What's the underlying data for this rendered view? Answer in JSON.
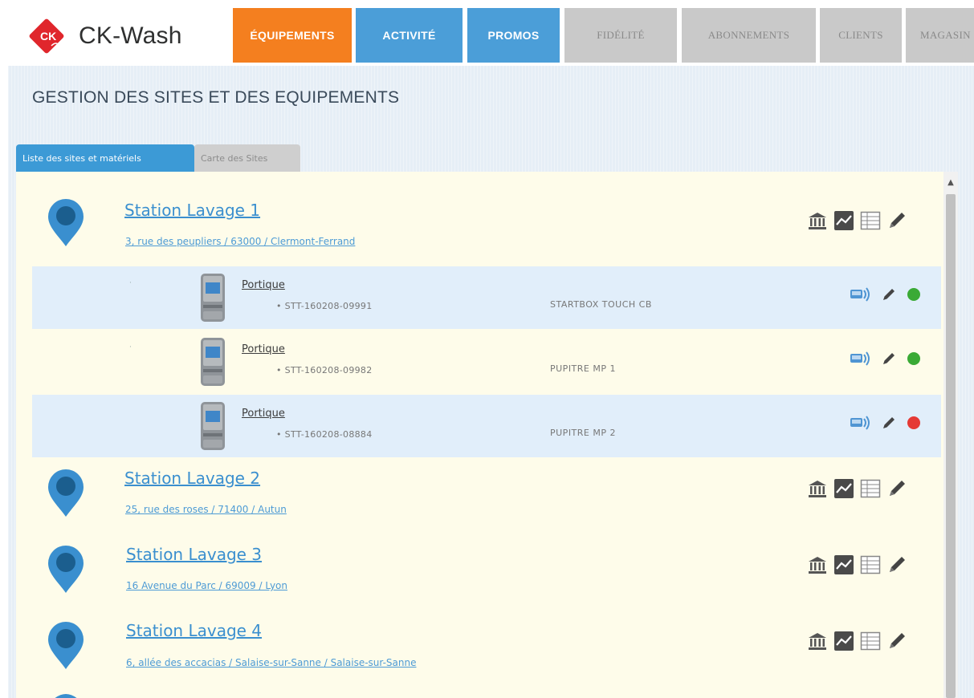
{
  "brand": {
    "name": "CK-Wash",
    "logo_text": "CK",
    "colors": {
      "red": "#e0262c"
    }
  },
  "nav": {
    "tabs": [
      {
        "label": "ÉQUIPEMENTS",
        "style": "orange",
        "color": "#f47f1f"
      },
      {
        "label": "ACTIVITÉ",
        "style": "blue",
        "color": "#4b9ed8"
      },
      {
        "label": "PROMOS",
        "style": "blue",
        "color": "#4b9ed8"
      },
      {
        "label": "FIDÉLITÉ",
        "style": "grey",
        "color": "#c9c9c9"
      },
      {
        "label": "ABONNEMENTS",
        "style": "grey",
        "color": "#c9c9c9"
      },
      {
        "label": "CLIENTS",
        "style": "grey",
        "color": "#c9c9c9"
      },
      {
        "label": "MAGASIN",
        "style": "grey",
        "color": "#c9c9c9"
      }
    ]
  },
  "page": {
    "title": "GESTION DES SITES ET DES EQUIPEMENTS"
  },
  "subtabs": [
    {
      "label": "Liste des sites et matériels",
      "active": true
    },
    {
      "label": "Carte des Sites",
      "active": false
    }
  ],
  "stations": [
    {
      "name": "Station Lavage 1",
      "address": "3, rue des peupliers / 63000 / Clermont-Ferrand",
      "actions": [
        "bank-icon",
        "chart-icon",
        "table-icon",
        "edit-icon"
      ],
      "equipment": [
        {
          "label": "Portique",
          "serial": "• STT-160208-09991",
          "model": "STARTBOX TOUCH CB",
          "status": "online",
          "status_color": "#3aaa35"
        },
        {
          "label": "Portique",
          "serial": "• STT-160208-09982",
          "model": "PUPITRE MP 1",
          "status": "online",
          "status_color": "#3aaa35"
        },
        {
          "label": "Portique",
          "serial": "• STT-160208-08884",
          "model": "PUPITRE MP 2",
          "status": "offline",
          "status_color": "#e53935"
        }
      ]
    },
    {
      "name": "Station Lavage 2",
      "address": "25, rue des roses / 71400 / Autun",
      "actions": [
        "bank-icon",
        "chart-icon",
        "table-icon",
        "edit-icon"
      ]
    },
    {
      "name": "Station Lavage 3",
      "address": "16 Avenue du Parc / 69009 / Lyon",
      "actions": [
        "bank-icon",
        "chart-icon",
        "table-icon",
        "edit-icon"
      ]
    },
    {
      "name": "Station Lavage 4",
      "address": "6, allée des accacias / Salaise-sur-Sanne / Salaise-sur-Sanne",
      "actions": [
        "bank-icon",
        "chart-icon",
        "table-icon",
        "edit-icon"
      ]
    }
  ],
  "colors": {
    "pin": "#3a8fcf",
    "pin_inner": "#1b5e8e",
    "link": "#3a8fcf",
    "panel_bg": "#fefcea",
    "row_tint": "#e1eefa"
  }
}
